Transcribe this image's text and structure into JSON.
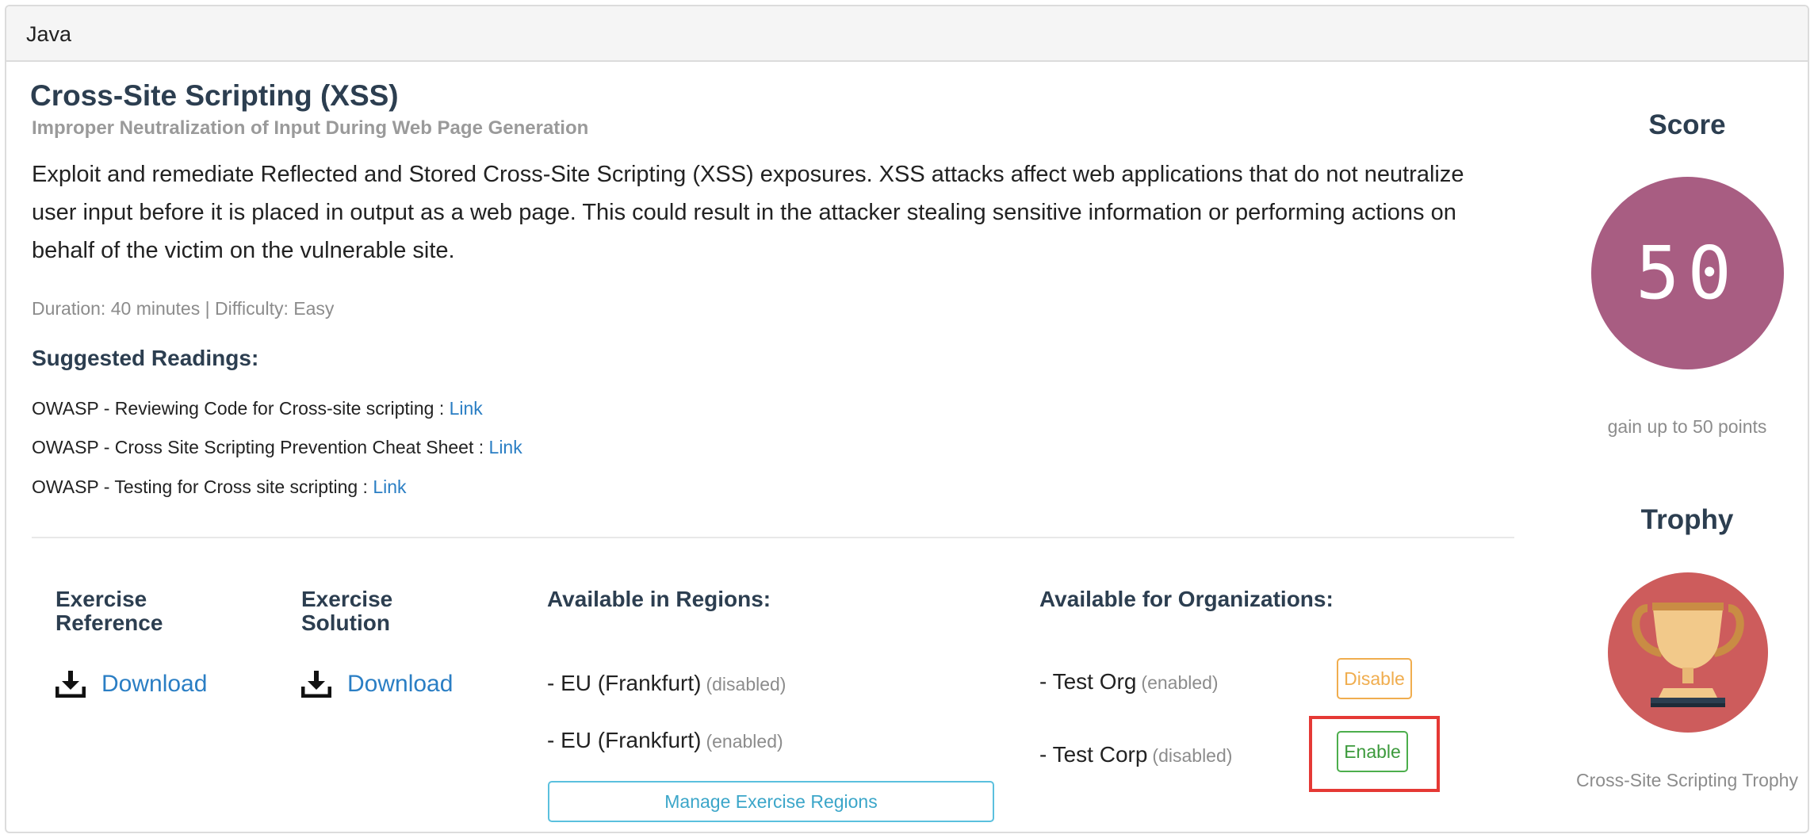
{
  "header": {
    "language": "Java"
  },
  "exercise": {
    "title": "Cross-Site Scripting (XSS)",
    "subtitle": "Improper Neutralization of Input During Web Page Generation",
    "description": "Exploit and remediate Reflected and Stored Cross-Site Scripting (XSS) exposures. XSS attacks affect web applications that do not neutralize user input before it is placed in output as a web page. This could result in the attacker stealing sensitive information or performing actions on behalf of the victim on the vulnerable site.",
    "meta": "Duration: 40 minutes | Difficulty: Easy"
  },
  "readings": {
    "title": "Suggested Readings:",
    "items": [
      {
        "label": "OWASP - Reviewing Code for Cross-site scripting : ",
        "link": "Link"
      },
      {
        "label": "OWASP - Cross Site Scripting Prevention Cheat Sheet : ",
        "link": "Link"
      },
      {
        "label": "OWASP - Testing for Cross site scripting : ",
        "link": "Link"
      }
    ]
  },
  "reference": {
    "title_line1": "Exercise",
    "title_line2": "Reference",
    "download_label": "Download",
    "icon": "download-icon"
  },
  "solution": {
    "title_line1": "Exercise",
    "title_line2": "Solution",
    "download_label": "Download",
    "icon": "download-icon"
  },
  "regions": {
    "title": "Available in Regions:",
    "items": [
      {
        "name": "- EU (Frankfurt)",
        "status": "(disabled)"
      },
      {
        "name": "- EU (Frankfurt)",
        "status": "(enabled)"
      }
    ],
    "manage_label": "Manage Exercise Regions"
  },
  "organizations": {
    "title": "Available for Organizations:",
    "items": [
      {
        "name": "- Test Org",
        "status": "(enabled)",
        "action": "Disable"
      },
      {
        "name": "- Test Corp",
        "status": "(disabled)",
        "action": "Enable"
      }
    ]
  },
  "score": {
    "title": "Score",
    "value": "50",
    "gain": "gain up to 50 points",
    "color": "#a85d82"
  },
  "trophy": {
    "title": "Trophy",
    "name": "Cross-Site Scripting Trophy",
    "icon": "trophy-icon",
    "color": "#cd5c5c"
  }
}
